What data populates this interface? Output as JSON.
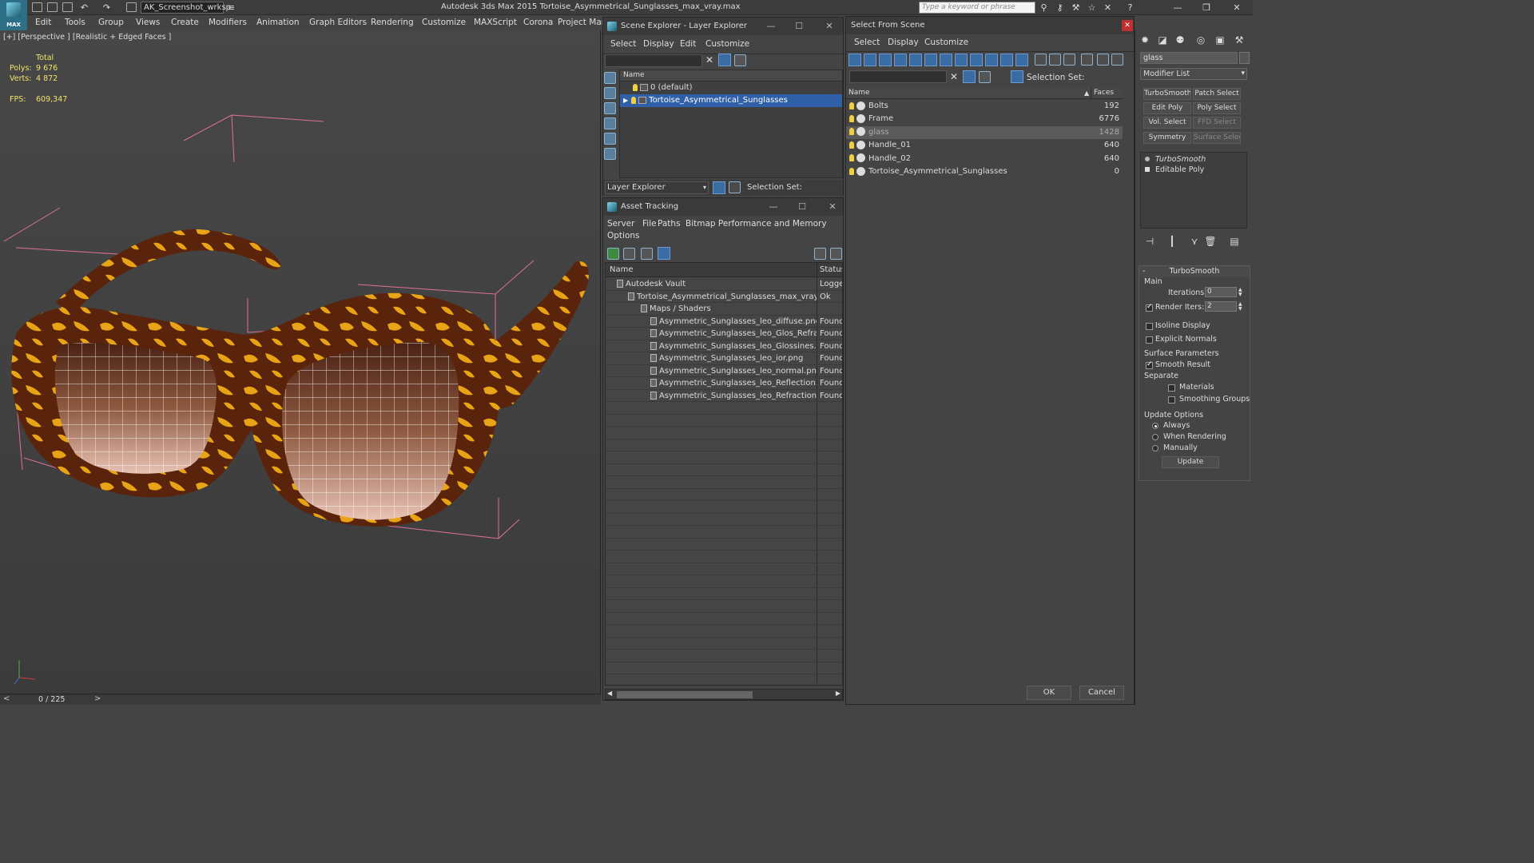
{
  "titlebar": {
    "logo_text": "MAX",
    "workspace": "AK_Screenshot_wrksp",
    "app_title": "Autodesk 3ds Max  2015     Tortoise_Asymmetrical_Sunglasses_max_vray.max",
    "search_placeholder": "Type a keyword or phrase"
  },
  "menubar": [
    "Edit",
    "Tools",
    "Group",
    "Views",
    "Create",
    "Modifiers",
    "Animation",
    "Graph Editors",
    "Rendering",
    "Customize",
    "MAXScript",
    "Corona",
    "Project Man"
  ],
  "viewport": {
    "label": "[+] [Perspective ] [Realistic + Edged Faces ]",
    "stats_total": "Total",
    "polys_label": "Polys:",
    "polys_value": "9 676",
    "verts_label": "Verts:",
    "verts_value": "4 872",
    "fps_label": "FPS:",
    "fps_value": "609,347"
  },
  "timebar": {
    "frame": "0 / 225"
  },
  "scene_explorer": {
    "title": "Scene Explorer - Layer Explorer",
    "menu": [
      "Select",
      "Display",
      "Edit",
      "Customize"
    ],
    "column": "Name",
    "layers": [
      {
        "name": "0 (default)",
        "selected": false
      },
      {
        "name": "Tortoise_Asymmetrical_Sunglasses",
        "selected": true
      }
    ],
    "combo": "Layer Explorer",
    "selection_set_label": "Selection Set:"
  },
  "asset_tracking": {
    "title": "Asset Tracking",
    "menu": [
      "Server",
      "File",
      "Paths",
      "Bitmap Performance and Memory",
      "Options"
    ],
    "col_name": "Name",
    "col_status": "Status",
    "rows": [
      {
        "name": "Autodesk Vault",
        "status": "Logged",
        "level": 1
      },
      {
        "name": "Tortoise_Asymmetrical_Sunglasses_max_vray.max",
        "status": "Ok",
        "level": 2
      },
      {
        "name": "Maps / Shaders",
        "status": "",
        "level": 3
      },
      {
        "name": "Asymmetric_Sunglasses_leo_diffuse.png",
        "status": "Found",
        "level": 4
      },
      {
        "name": "Asymmetric_Sunglasses_leo_Glos_Refract....",
        "status": "Found",
        "level": 4
      },
      {
        "name": "Asymmetric_Sunglasses_leo_Glossines.png",
        "status": "Found",
        "level": 4
      },
      {
        "name": "Asymmetric_Sunglasses_leo_ior.png",
        "status": "Found",
        "level": 4
      },
      {
        "name": "Asymmetric_Sunglasses_leo_normal.png",
        "status": "Found",
        "level": 4
      },
      {
        "name": "Asymmetric_Sunglasses_leo_Reflection.png",
        "status": "Found",
        "level": 4
      },
      {
        "name": "Asymmetric_Sunglasses_leo_Refraction.png",
        "status": "Found",
        "level": 4
      }
    ]
  },
  "select_from_scene": {
    "title": "Select From Scene",
    "menu": [
      "Select",
      "Display",
      "Customize"
    ],
    "selection_set_label": "Selection Set:",
    "col_name": "Name",
    "col_faces": "Faces",
    "objects": [
      {
        "name": "Bolts",
        "faces": "192",
        "selected": false
      },
      {
        "name": "Frame",
        "faces": "6776",
        "selected": false
      },
      {
        "name": "glass",
        "faces": "1428",
        "selected": true
      },
      {
        "name": "Handle_01",
        "faces": "640",
        "selected": false
      },
      {
        "name": "Handle_02",
        "faces": "640",
        "selected": false
      },
      {
        "name": "Tortoise_Asymmetrical_Sunglasses",
        "faces": "0",
        "selected": false
      }
    ],
    "ok_label": "OK",
    "cancel_label": "Cancel"
  },
  "command_panel": {
    "object_name": "glass",
    "modifier_list": "Modifier List",
    "buttons": [
      "TurboSmooth",
      "Patch Select",
      "Edit Poly",
      "Poly Select",
      "Vol. Select",
      "FFD Select",
      "Symmetry",
      "Surface Select"
    ],
    "stack": [
      "TurboSmooth",
      "Editable Poly"
    ],
    "rollout_title": "TurboSmooth",
    "main_label": "Main",
    "iterations_label": "Iterations:",
    "iterations_value": "0",
    "render_iters_label": "Render Iters:",
    "render_iters_value": "2",
    "isoline_label": "Isoline Display",
    "explicit_normals_label": "Explicit Normals",
    "surface_params_label": "Surface Parameters",
    "smooth_result_label": "Smooth Result",
    "separate_label": "Separate",
    "materials_label": "Materials",
    "smoothing_groups_label": "Smoothing Groups",
    "update_options_label": "Update Options",
    "always_label": "Always",
    "when_rendering_label": "When Rendering",
    "manually_label": "Manually",
    "update_button": "Update"
  },
  "colors": {
    "selection_blue": "#2f5fa7",
    "stats_yellow": "#f2e36b",
    "bbox_pink": "#e0709a",
    "tortoise_dark": "#5a240c",
    "tortoise_light": "#e8a317"
  }
}
